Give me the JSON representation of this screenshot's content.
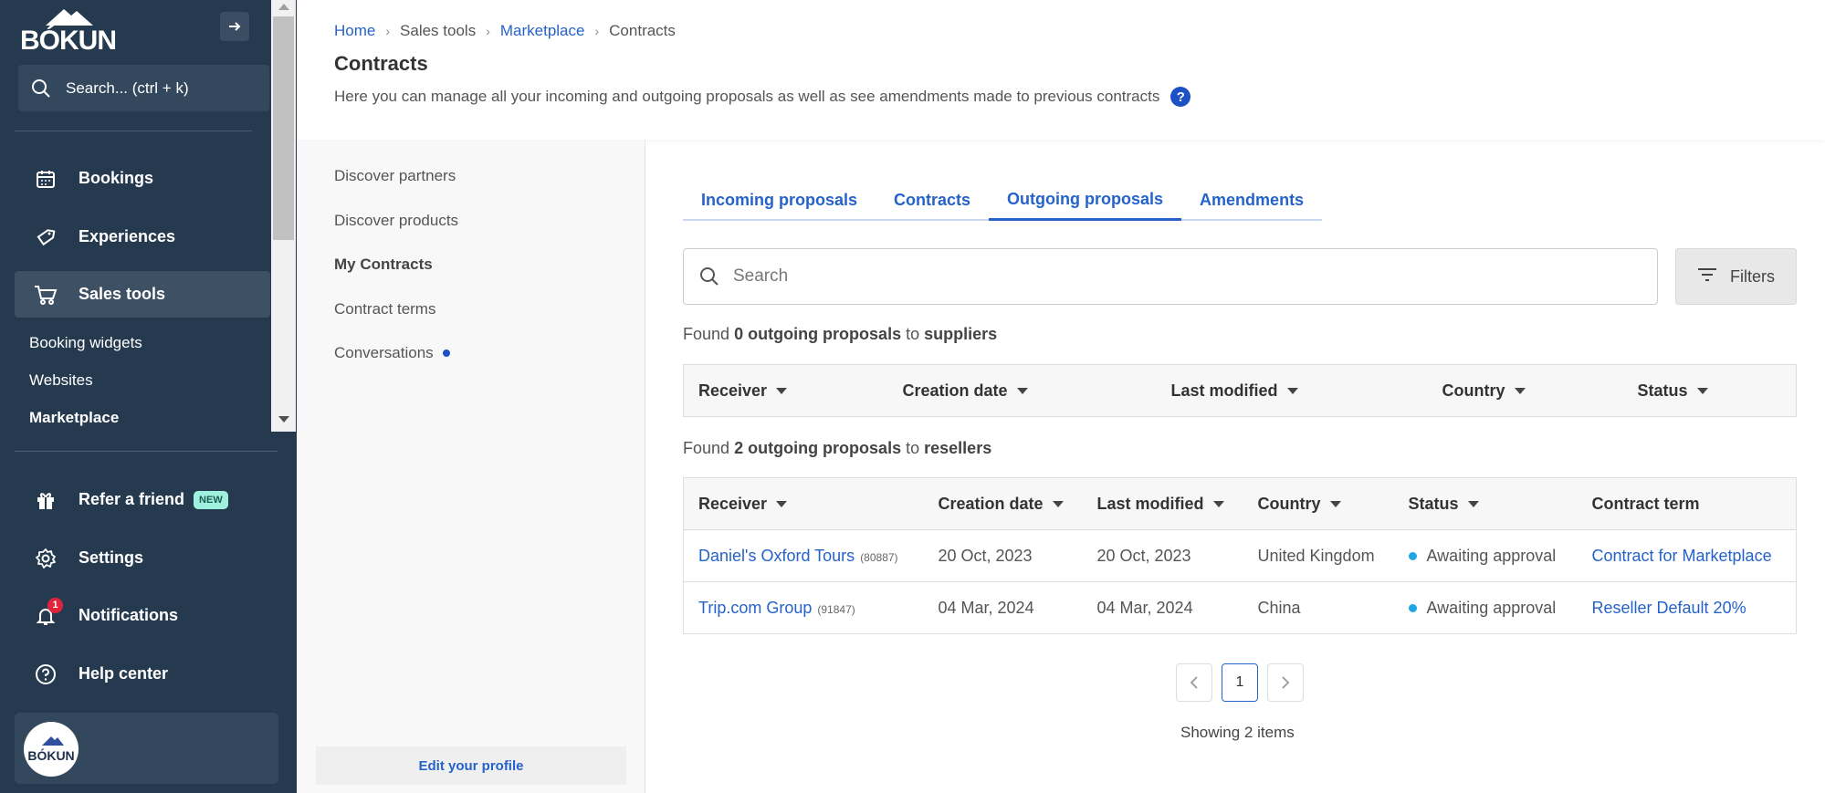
{
  "app": {
    "logo": "BÓKUN",
    "avatar_logo": "BÓKUN"
  },
  "sidebar": {
    "search_label": "Search... (ctrl + k)",
    "items": [
      {
        "label": "Bookings",
        "icon": "calendar-icon"
      },
      {
        "label": "Experiences",
        "icon": "tag-icon"
      },
      {
        "label": "Sales tools",
        "icon": "cart-icon",
        "active": true
      }
    ],
    "sub_items": [
      {
        "label": "Booking widgets"
      },
      {
        "label": "Websites"
      },
      {
        "label": "Marketplace",
        "active": true
      }
    ],
    "bottom_items": [
      {
        "label": "Refer a friend",
        "icon": "gift-icon",
        "badge": "NEW"
      },
      {
        "label": "Settings",
        "icon": "gear-icon"
      },
      {
        "label": "Notifications",
        "icon": "bell-icon",
        "count": "1"
      },
      {
        "label": "Help center",
        "icon": "help-circle-icon"
      }
    ]
  },
  "breadcrumb": [
    "Home",
    "Sales tools",
    "Marketplace",
    "Contracts"
  ],
  "header": {
    "title": "Contracts",
    "description": "Here you can manage all your incoming and outgoing proposals as well as see amendments made to previous contracts",
    "help": "?"
  },
  "subnav": {
    "items": [
      "Discover partners",
      "Discover products",
      "My Contracts",
      "Contract terms",
      "Conversations"
    ],
    "edit_profile": "Edit your profile"
  },
  "tabs": [
    "Incoming proposals",
    "Contracts",
    "Outgoing proposals",
    "Amendments"
  ],
  "search": {
    "placeholder": "Search"
  },
  "filters_label": "Filters",
  "suppliers": {
    "found_prefix": "Found",
    "count": "0",
    "noun": "outgoing proposals",
    "to": "to",
    "target": "suppliers",
    "columns": [
      "Receiver",
      "Creation date",
      "Last modified",
      "Country",
      "Status"
    ]
  },
  "resellers": {
    "found_prefix": "Found",
    "count": "2",
    "noun": "outgoing proposals",
    "to": "to",
    "target": "resellers",
    "columns": [
      "Receiver",
      "Creation date",
      "Last modified",
      "Country",
      "Status",
      "Contract term"
    ],
    "rows": [
      {
        "receiver": "Daniel's Oxford Tours",
        "id": "(80887)",
        "created": "20 Oct, 2023",
        "modified": "20 Oct, 2023",
        "country": "United Kingdom",
        "status": "Awaiting approval",
        "term": "Contract for Marketplace"
      },
      {
        "receiver": "Trip.com Group",
        "id": "(91847)",
        "created": "04 Mar, 2024",
        "modified": "04 Mar, 2024",
        "country": "China",
        "status": "Awaiting approval",
        "term": "Reseller Default 20%"
      }
    ]
  },
  "pagination": {
    "current": "1",
    "showing": "Showing 2 items"
  },
  "colors": {
    "sidebar": "#263a4f",
    "accent": "#2563c9",
    "status_dot": "#1ea7e4",
    "notif": "#e0243b"
  }
}
